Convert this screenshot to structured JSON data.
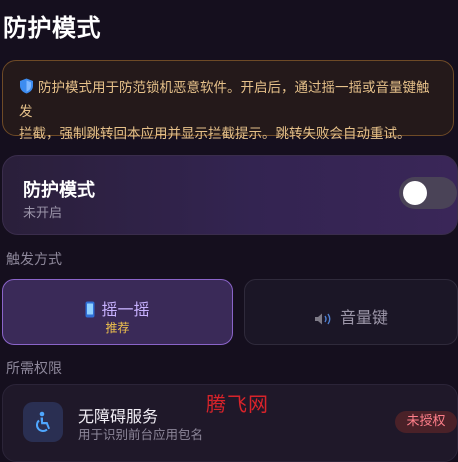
{
  "page": {
    "title": "防护模式"
  },
  "notice": {
    "icon": "shield-icon",
    "line1": "防护模式用于防范锁机恶意软件。开启后，通过摇一摇或音量键触发",
    "line2": "拦截，强制跳转回本应用并显示拦截提示。跳转失败会自动重试。"
  },
  "protection": {
    "title": "防护模式",
    "status": "未开启",
    "enabled": false
  },
  "trigger": {
    "section_label": "触发方式",
    "options": [
      {
        "label": "摇一摇",
        "icon": "phone-icon",
        "tag": "推荐",
        "selected": true
      },
      {
        "label": "音量键",
        "icon": "speaker-icon",
        "selected": false
      }
    ]
  },
  "permissions": {
    "section_label": "所需权限",
    "items": [
      {
        "title": "无障碍服务",
        "desc": "用于识别前台应用包名",
        "icon": "accessibility-icon",
        "badge": "未授权"
      }
    ]
  },
  "watermark": "腾飞网",
  "colors": {
    "background": "#150f1e",
    "accent": "#8a64c9",
    "warning_text": "#e6c18a",
    "tag": "#f0c24d",
    "unauthorized": "#ff7f8a"
  }
}
